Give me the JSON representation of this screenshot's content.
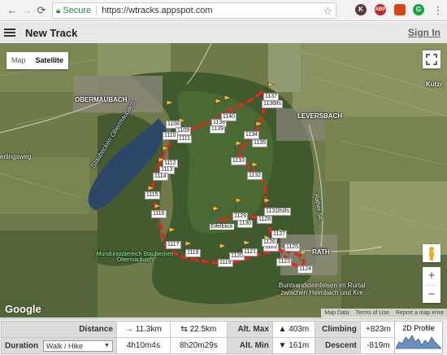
{
  "browser": {
    "back": "←",
    "forward": "→",
    "reload": "⟳",
    "secure": "Secure",
    "url": "https://wtracks.appspot.com",
    "extensions": [
      {
        "name": "k-extension",
        "label": "K",
        "color": "#5a3a3a"
      },
      {
        "name": "adblock-extension",
        "label": "ABP",
        "color": "#c62828"
      },
      {
        "name": "red-extension",
        "label": "",
        "color": "#d84315"
      },
      {
        "name": "grammarly-extension",
        "label": "G",
        "color": "#17a34a"
      }
    ]
  },
  "header": {
    "title": "New Track",
    "signin": "Sign In"
  },
  "map": {
    "type_map": "Map",
    "type_satellite": "Satellite",
    "google": "Google",
    "attribution": {
      "map_data": "Map Data",
      "terms": "Terms of Use",
      "report": "Report a map error"
    },
    "places": {
      "obermaubach": "OBERMAUBACH",
      "leversbach": "LEVERSBACH",
      "rath": "RATH",
      "kutzr": "Kutzr",
      "lake": "Staubecken Obermaubach",
      "lingsweg": "erlingsweg",
      "reserve": "Mundungsbereich Staubecken Obermaubach",
      "buntsand": "Buntsandsteinfelsen im Rurtal zwischen Heimbach und Kre",
      "eifelblick": "Eifelblick",
      "rathstr": "Rather Str."
    },
    "waypoints": [
      "1108",
      "1109",
      "1110",
      "1111",
      "1112",
      "1113",
      "1114",
      "1115",
      "1116",
      "1117",
      "1118",
      "1119",
      "1120",
      "1121",
      "1122",
      "1123",
      "1124",
      "1125",
      "1126",
      "1127",
      "1128",
      "1129",
      "1130",
      "1131lfslfs",
      "1132",
      "1133",
      "1134",
      "1135",
      "1136lfs",
      "1137",
      "1138",
      "1139",
      "1140"
    ]
  },
  "stats": {
    "distance_label": "Distance",
    "distance_oneway": "→ 11.3km",
    "distance_return": "⇆ 22.5km",
    "alt_max_label": "Alt. Max",
    "alt_max": "▲ 403m",
    "climbing_label": "Climbing",
    "climbing": "+823m",
    "duration_label": "Duration",
    "activity": "Walk / Hike",
    "duration_oneway": "4h10m4s",
    "duration_return": "8h20m29s",
    "alt_min_label": "Alt. Min",
    "alt_min": "▼ 161m",
    "descent_label": "Descent",
    "descent": "-819m",
    "profile_label": "2D Profile"
  }
}
